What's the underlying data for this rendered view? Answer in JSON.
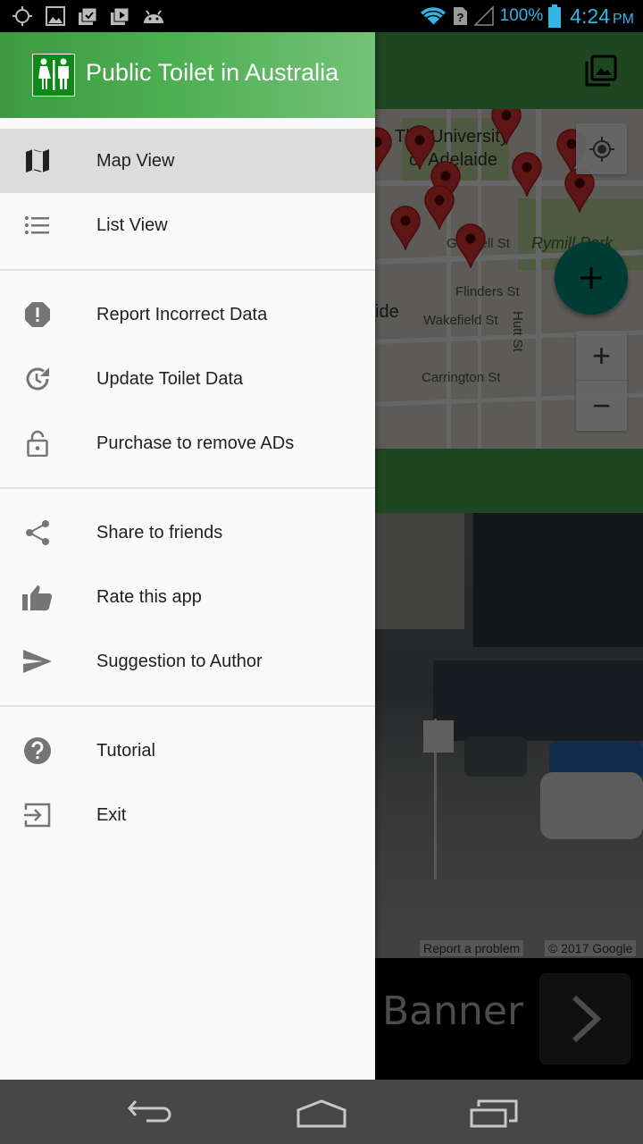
{
  "status_bar": {
    "left_icons": [
      "gps-icon",
      "image-icon",
      "store-check-icon",
      "store-play-icon",
      "android-icon"
    ],
    "right_icons": [
      "wifi-icon",
      "no-sim-icon",
      "signal-icon",
      "battery-icon"
    ],
    "battery_percent": "100%",
    "time": "4:24",
    "ampm": "PM",
    "accent_color": "#33b5e5"
  },
  "drawer": {
    "app_title": "Public Toilet in Australia",
    "logo_icon": "toilet-men-women-icon",
    "header_color": "#4caf50",
    "sections": [
      {
        "items": [
          {
            "label": "Map View",
            "icon": "map-icon",
            "active": true
          },
          {
            "label": "List View",
            "icon": "list-icon",
            "active": false
          }
        ]
      },
      {
        "items": [
          {
            "label": "Report Incorrect Data",
            "icon": "report-icon",
            "active": false
          },
          {
            "label": "Update Toilet Data",
            "icon": "update-icon",
            "active": false
          },
          {
            "label": "Purchase to remove ADs",
            "icon": "lock-open-icon",
            "active": false
          }
        ]
      },
      {
        "items": [
          {
            "label": "Share to friends",
            "icon": "share-icon",
            "active": false
          },
          {
            "label": "Rate this app",
            "icon": "thumb-up-icon",
            "active": false
          },
          {
            "label": "Suggestion to Author",
            "icon": "send-icon",
            "active": false
          }
        ]
      },
      {
        "items": [
          {
            "label": "Tutorial",
            "icon": "help-icon",
            "active": false
          },
          {
            "label": "Exit",
            "icon": "exit-icon",
            "active": false
          }
        ]
      }
    ]
  },
  "background": {
    "toolbar_icon": "photo-library-icon",
    "map_labels": {
      "university": "The University of Adelaide",
      "university_line1": "The University",
      "university_line2": "of Adelaide",
      "street1": "Grenfell St",
      "park": "Rymill Park",
      "street2": "Flinders St",
      "city_fragment": "ide",
      "street3": "Wakefield St",
      "street4": "Hutt St",
      "street5": "Carrington St"
    },
    "fab_icon": "add-icon",
    "zoom_in": "+",
    "zoom_out": "−",
    "streetview": {
      "report": "Report a problem",
      "copyright": "© 2017 Google"
    },
    "banner": {
      "text": "Banner",
      "button_icon": "chevron-right-icon"
    }
  },
  "nav_bar": {
    "buttons": [
      "back-icon",
      "home-icon",
      "recents-icon"
    ]
  }
}
